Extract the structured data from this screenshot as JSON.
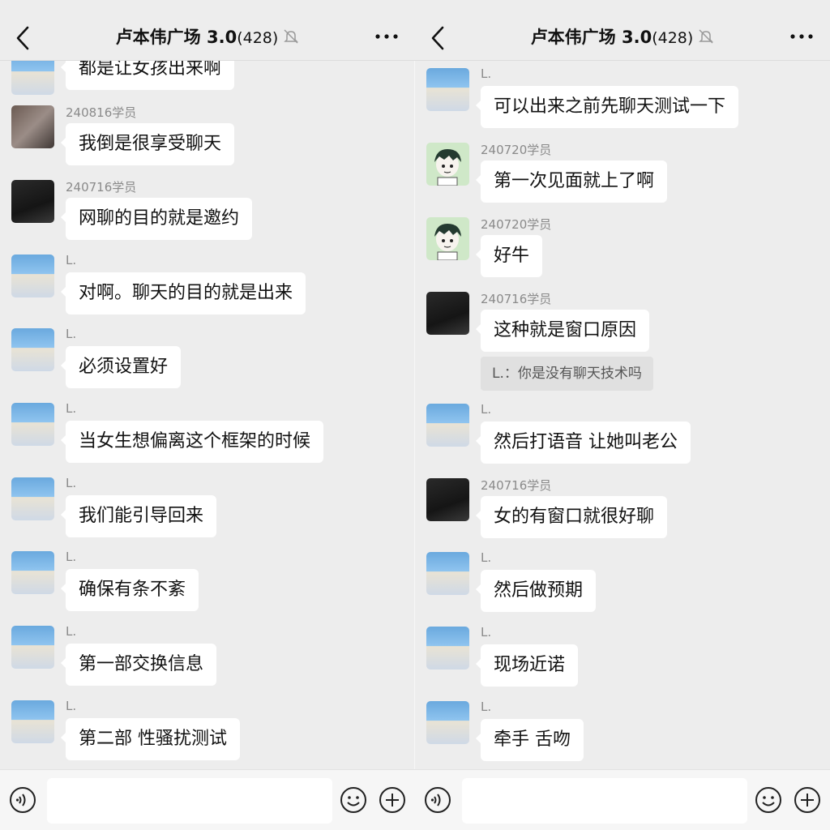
{
  "colors": {
    "background": "#ededed",
    "bubble": "#ffffff",
    "text": "#111111",
    "sender": "#8a8a8a",
    "quote_bg": "#e0e0e0"
  },
  "left": {
    "header": {
      "title": "卢本伟广场 3.0",
      "count": "(428)",
      "icons": [
        "back-icon",
        "mute-icon",
        "more-icon"
      ]
    },
    "messages": [
      {
        "sender": "",
        "avatar": "boy",
        "text": "都是让女孩出来啊"
      },
      {
        "sender": "240816学员",
        "avatar": "photo",
        "text": "我倒是很享受聊天"
      },
      {
        "sender": "240716学员",
        "avatar": "dark",
        "text": "网聊的目的就是邀约"
      },
      {
        "sender": "L.",
        "avatar": "boy",
        "text": "对啊。聊天的目的就是出来"
      },
      {
        "sender": "L.",
        "avatar": "boy",
        "text": "必须设置好"
      },
      {
        "sender": "L.",
        "avatar": "boy",
        "text": "当女生想偏离这个框架的时候"
      },
      {
        "sender": "L.",
        "avatar": "boy",
        "text": "我们能引导回来"
      },
      {
        "sender": "L.",
        "avatar": "boy",
        "text": "确保有条不紊"
      },
      {
        "sender": "L.",
        "avatar": "boy",
        "text": "第一部交换信息"
      },
      {
        "sender": "L.",
        "avatar": "boy",
        "text": "第二部 性骚扰测试"
      }
    ],
    "input": {
      "value": "",
      "icons": [
        "voice-icon",
        "emoji-icon",
        "plus-icon"
      ]
    }
  },
  "right": {
    "header": {
      "title": "卢本伟广场 3.0",
      "count": "(428)",
      "icons": [
        "back-icon",
        "mute-icon",
        "more-icon"
      ]
    },
    "messages": [
      {
        "sender": "L.",
        "avatar": "boy",
        "text": "可以出来之前先聊天测试一下"
      },
      {
        "sender": "240720学员",
        "avatar": "cartoon",
        "text": "第一次见面就上了啊"
      },
      {
        "sender": "240720学员",
        "avatar": "cartoon",
        "text": "好牛"
      },
      {
        "sender": "240716学员",
        "avatar": "dark",
        "text": "这种就是窗口原因",
        "quote": "L.：你是没有聊天技术吗"
      },
      {
        "sender": "L.",
        "avatar": "boy",
        "text": "然后打语音 让她叫老公"
      },
      {
        "sender": "240716学员",
        "avatar": "dark",
        "text": "女的有窗口就很好聊"
      },
      {
        "sender": "L.",
        "avatar": "boy",
        "text": "然后做预期"
      },
      {
        "sender": "L.",
        "avatar": "boy",
        "text": "现场近诺"
      },
      {
        "sender": "L.",
        "avatar": "boy",
        "text": "牵手 舌吻"
      }
    ],
    "input": {
      "value": "",
      "icons": [
        "voice-icon",
        "emoji-icon",
        "plus-icon"
      ]
    }
  }
}
